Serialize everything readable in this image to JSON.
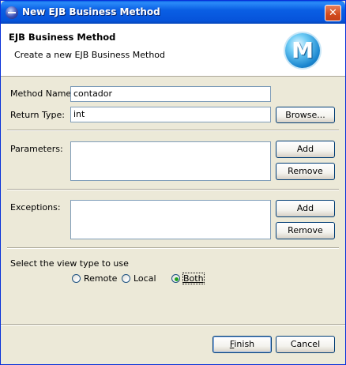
{
  "window": {
    "title": "New EJB Business Method",
    "close_symbol": "✕"
  },
  "banner": {
    "title": "EJB Business Method",
    "description": "Create a new EJB Business Method",
    "logo_letter": "M"
  },
  "method_name": {
    "label": "Method Name:",
    "value": "contador"
  },
  "return_type": {
    "label": "Return Type:",
    "value": "int",
    "browse_label": "Browse..."
  },
  "parameters": {
    "label": "Parameters:",
    "add_label": "Add",
    "remove_label": "Remove"
  },
  "exceptions": {
    "label": "Exceptions:",
    "add_label": "Add",
    "remove_label": "Remove"
  },
  "view_type": {
    "label": "Select the view type to use",
    "options": [
      {
        "label": "Remote",
        "checked": false
      },
      {
        "label": "Local",
        "checked": false
      },
      {
        "label": "Both",
        "checked": true
      }
    ]
  },
  "footer": {
    "finish_label": "Finish",
    "cancel_label": "Cancel"
  },
  "colors": {
    "title_bar": "#0a5fe4",
    "dialog_bg": "#ece9d8",
    "close_button": "#d24b1d",
    "radio_selected": "#21a121"
  }
}
